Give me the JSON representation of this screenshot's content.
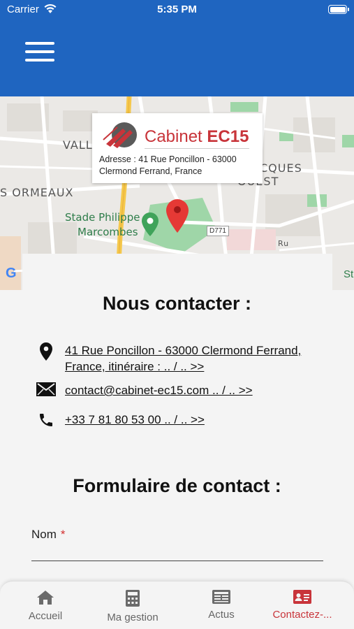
{
  "status_bar": {
    "carrier": "Carrier",
    "time": "5:35 PM"
  },
  "header": {
    "menu_icon": "hamburger-menu-icon"
  },
  "map": {
    "labels": {
      "vall": "VALL",
      "ormeaux": "S ORMEAUX",
      "jacques": "CQUES",
      "ouest": "OUEST",
      "stade": "Stade Philippe",
      "marcombes": "Marcombes",
      "road": "D771",
      "ru": "Ru",
      "st": "St"
    },
    "info_card": {
      "brand_prefix": "Cabinet ",
      "brand_bold": "EC15",
      "address_line1": "Adresse : 41 Rue Poncillon - 63000",
      "address_line2": "Clermond Ferrand, France"
    }
  },
  "contact": {
    "title": "Nous contacter :",
    "address_link": "41 Rue Poncillon - 63000 Clermond Ferrand, France, itinéraire : .. / .. >>",
    "email_link": "contact@cabinet-ec15.com .. / .. >>",
    "phone_link": "+33 7 81 80 53 00  .. / .. >>"
  },
  "form": {
    "title": "Formulaire de contact :",
    "name_label": "Nom",
    "required_mark": "*",
    "name_value": ""
  },
  "tabs": [
    {
      "label": "Accueil",
      "icon": "home-icon"
    },
    {
      "label": "Ma gestion",
      "icon": "calculator-icon"
    },
    {
      "label": "Actus",
      "icon": "newspaper-icon"
    },
    {
      "label": "Contactez-...",
      "icon": "contact-card-icon",
      "active": true
    }
  ],
  "colors": {
    "header": "#1f65c0",
    "accent": "#c8343a",
    "park": "#9fd6a8"
  }
}
